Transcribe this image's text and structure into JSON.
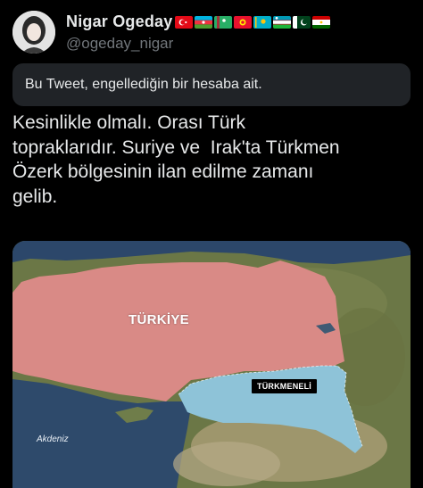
{
  "author": {
    "display_name": "Nigar Ogeday",
    "handle": "@ogeday_nigar",
    "flags": [
      "turkey-flag",
      "azerbaijan-flag",
      "turkmenistan-flag",
      "kyrgyzstan-flag",
      "kazakhstan-flag",
      "uzbekistan-flag",
      "pakistan-flag",
      "tajikistan-flag"
    ]
  },
  "blocked_notice": "Bu Tweet, engellediğin bir hesaba ait.",
  "tweet_text": "Kesinlikle olmalı. Orası Türk\ntopraklarıdır. Suriye ve  Irak'ta Türkmen\nÖzerk bölgesinin ilan edilme zamanı\ngelib.",
  "map": {
    "labels": {
      "turkiye": "TÜRKİYE",
      "turkmeneli": "TÜRKMENELİ",
      "akdeniz": "Akdeniz"
    },
    "colors": {
      "turkiye_fill": "#d98a86",
      "turkmeneli_fill": "#8ec3d8",
      "sea": "#2e4a6b",
      "land": "#6f7d4a"
    }
  },
  "colors": {
    "background": "#000000",
    "text_primary": "#e7e9ea",
    "text_secondary": "#71767b",
    "banner_bg": "#202327"
  }
}
